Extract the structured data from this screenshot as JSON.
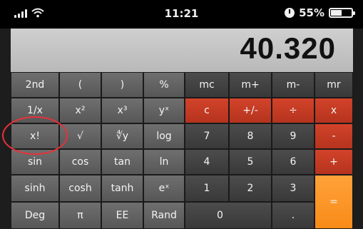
{
  "status_bar": {
    "time": "11:21",
    "battery_text": "55%",
    "battery_level": 0.55,
    "icons": [
      "signal-icon",
      "wifi-icon",
      "alarm-clock-icon",
      "battery-icon"
    ]
  },
  "display": {
    "value": "40.320"
  },
  "keys": {
    "2nd": "2nd",
    "open_paren": "(",
    "close_paren": ")",
    "percent": "%",
    "mc": "mc",
    "m_plus": "m+",
    "m_minus": "m-",
    "mr": "mr",
    "reciprocal": "1/x",
    "x_squared": "x²",
    "x_cubed": "x³",
    "y_pow_x": "yˣ",
    "clear": "c",
    "plus_minus": "+/-",
    "divide": "÷",
    "multiply": "x",
    "factorial": "x!",
    "sqrt": "√",
    "y_root": "∜y",
    "log": "log",
    "seven": "7",
    "eight": "8",
    "nine": "9",
    "minus": "-",
    "sin": "sin",
    "cos": "cos",
    "tan": "tan",
    "ln": "ln",
    "four": "4",
    "five": "5",
    "six": "6",
    "plus": "+",
    "sinh": "sinh",
    "cosh": "cosh",
    "tanh": "tanh",
    "e_pow_x": "eˣ",
    "one": "1",
    "two": "2",
    "three": "3",
    "equals": "=",
    "deg": "Deg",
    "pi": "π",
    "ee": "EE",
    "rand": "Rand",
    "zero": "0",
    "decimal": "."
  },
  "colors": {
    "function_key": "#626262",
    "number_key": "#424242",
    "operator_key": "#c53c24",
    "equals_key": "#fb951f",
    "display_bg": "#c4c4c4",
    "callout": "#e8313a"
  }
}
